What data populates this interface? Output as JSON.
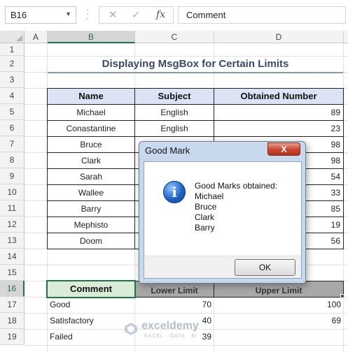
{
  "formula_bar": {
    "name_box": "B16",
    "formula": "Comment",
    "cancel_icon": "close-icon",
    "enter_icon": "check-icon",
    "fx_label": "fx"
  },
  "columns": [
    "A",
    "B",
    "C",
    "D"
  ],
  "rows": [
    "1",
    "2",
    "3",
    "4",
    "5",
    "6",
    "7",
    "8",
    "9",
    "10",
    "11",
    "12",
    "13",
    "14",
    "15",
    "16",
    "17",
    "18",
    "19"
  ],
  "sheet": {
    "title": "Displaying MsgBox for Certain Limits",
    "table": {
      "headers": [
        "Name",
        "Subject",
        "Obtained Number"
      ],
      "rows": [
        {
          "name": "Michael",
          "subject": "English",
          "number": "89"
        },
        {
          "name": "Conastantine",
          "subject": "English",
          "number": "23"
        },
        {
          "name": "Bruce",
          "subject": "",
          "number": "98"
        },
        {
          "name": "Clark",
          "subject": "",
          "number": "98"
        },
        {
          "name": "Sarah",
          "subject": "",
          "number": "54"
        },
        {
          "name": "Wallee",
          "subject": "",
          "number": "33"
        },
        {
          "name": "Barry",
          "subject": "",
          "number": "85"
        },
        {
          "name": "Mephisto",
          "subject": "",
          "number": "19"
        },
        {
          "name": "Doom",
          "subject": "",
          "number": "56"
        }
      ]
    },
    "limits": {
      "headers": [
        "Comment",
        "Lower Limit",
        "Upper Limit"
      ],
      "rows": [
        {
          "comment": "Good",
          "lower": "70",
          "upper": "100"
        },
        {
          "comment": "Satisfactory",
          "lower": "40",
          "upper": "69"
        },
        {
          "comment": "Failed",
          "lower": "39",
          "upper": ""
        }
      ]
    }
  },
  "dialog": {
    "title": "Good Mark",
    "close_label": "X",
    "icon": "info-icon",
    "message_lines": [
      "Good Marks obtained:",
      "Michael",
      "Bruce",
      "Clark",
      "Barry"
    ],
    "ok_label": "OK"
  },
  "watermark": {
    "name": "exceldemy",
    "tagline": "EXCEL · DATA · BI"
  },
  "colors": {
    "accent": "#217346",
    "header_fill": "#dbe3f4",
    "comment_fill": "#d9ecd8",
    "title_color": "#3a4a6c"
  }
}
